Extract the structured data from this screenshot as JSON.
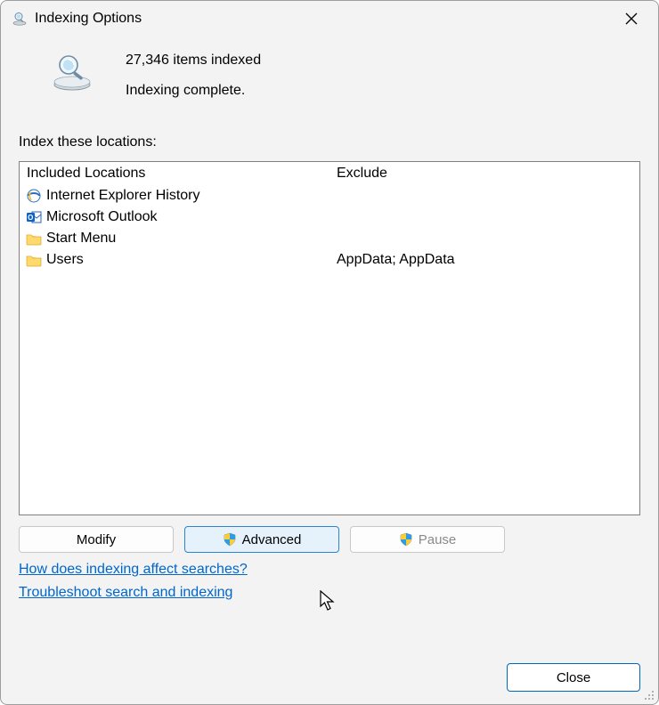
{
  "window": {
    "title": "Indexing Options"
  },
  "summary": {
    "count_line": "27,346 items indexed",
    "status_line": "Indexing complete."
  },
  "locations": {
    "section_label": "Index these locations:",
    "included_header": "Included Locations",
    "exclude_header": "Exclude",
    "items": [
      {
        "icon": "ie-icon",
        "label": "Internet Explorer History",
        "exclude": ""
      },
      {
        "icon": "outlook-icon",
        "label": "Microsoft Outlook",
        "exclude": ""
      },
      {
        "icon": "folder-icon",
        "label": "Start Menu",
        "exclude": ""
      },
      {
        "icon": "folder-icon",
        "label": "Users",
        "exclude": "AppData; AppData"
      }
    ]
  },
  "buttons": {
    "modify": "Modify",
    "advanced": "Advanced",
    "pause": "Pause",
    "close": "Close"
  },
  "links": {
    "help": "How does indexing affect searches?",
    "troubleshoot": "Troubleshoot search and indexing"
  }
}
